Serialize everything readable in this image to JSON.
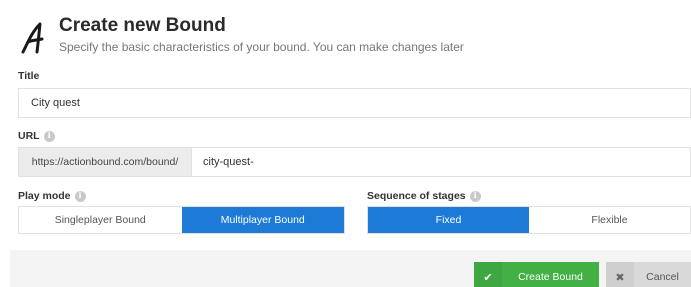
{
  "header": {
    "title": "Create new Bound",
    "subtitle": "Specify the basic characteristics of your bound. You can make changes later",
    "logo_icon": "actionbound-logo"
  },
  "form": {
    "title_label": "Title",
    "title_value": "City quest",
    "url_label": "URL",
    "url_prefix": "https://actionbound.com/bound/",
    "url_value": "city-quest-",
    "play_mode_label": "Play mode",
    "play_mode_options": [
      "Singleplayer Bound",
      "Multiplayer Bound"
    ],
    "play_mode_selected": "Multiplayer Bound",
    "sequence_label": "Sequence of stages",
    "sequence_options": [
      "Fixed",
      "Flexible"
    ],
    "sequence_selected": "Fixed"
  },
  "footer": {
    "create_label": "Create Bound",
    "cancel_label": "Cancel",
    "check_icon": "✔",
    "close_icon": "✖"
  },
  "colors": {
    "accent_blue": "#1d7bd7",
    "create_green": "#43b046",
    "cancel_gray": "#d9d9d9"
  }
}
